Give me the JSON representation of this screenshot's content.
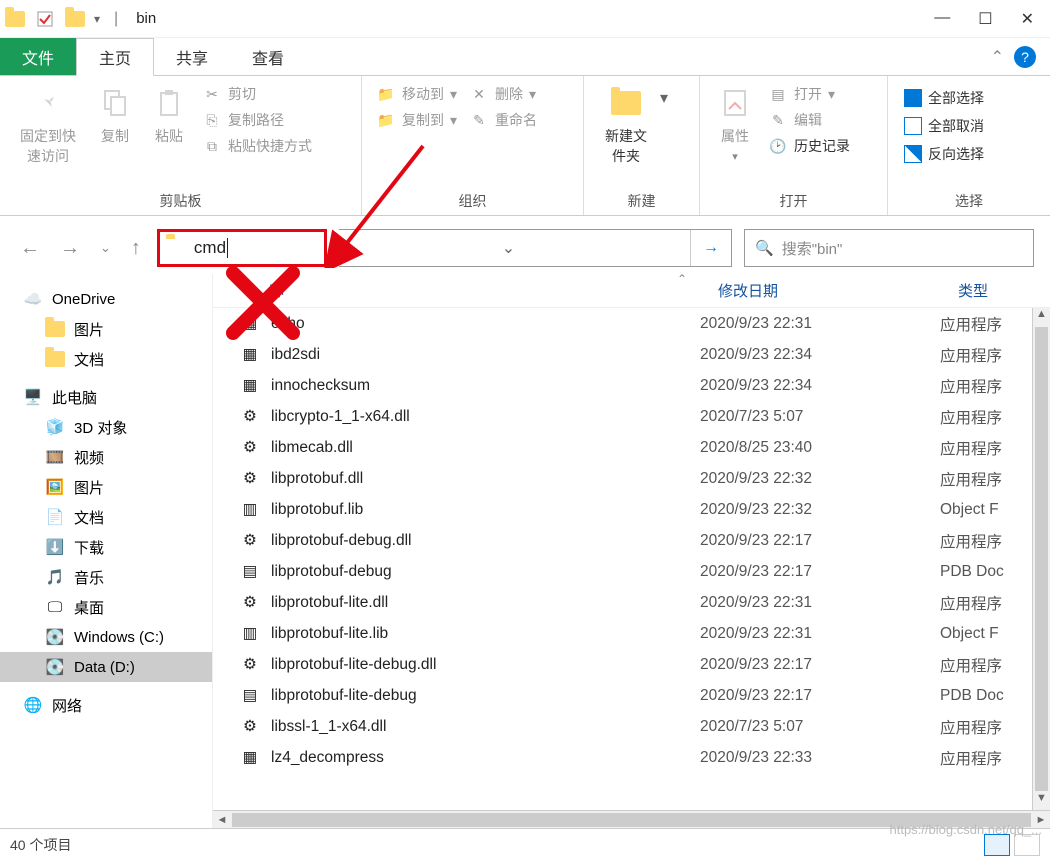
{
  "window": {
    "title": "bin"
  },
  "tabs": {
    "file": "文件",
    "home": "主页",
    "share": "共享",
    "view": "查看"
  },
  "ribbon": {
    "pin": "固定到快速访问",
    "copy": "复制",
    "paste": "粘贴",
    "cut": "剪切",
    "copypath": "复制路径",
    "pasteshortcut": "粘贴快捷方式",
    "clipboard_label": "剪贴板",
    "moveto": "移动到",
    "copyto": "复制到",
    "delete": "删除",
    "rename": "重命名",
    "organize_label": "组织",
    "newfolder": "新建文件夹",
    "new_label": "新建",
    "properties": "属性",
    "open": "打开",
    "edit": "编辑",
    "history": "历史记录",
    "open_label": "打开",
    "selectall": "全部选择",
    "selectnone": "全部取消",
    "invert": "反向选择",
    "select_label": "选择"
  },
  "address": {
    "value": "cmd",
    "search_placeholder": "搜索\"bin\""
  },
  "columns": {
    "name": "称",
    "date": "修改日期",
    "type": "类型"
  },
  "sidebar": {
    "onedrive": "OneDrive",
    "pictures": "图片",
    "documents": "文档",
    "thispc": "此电脑",
    "objects3d": "3D 对象",
    "videos": "视频",
    "pictures2": "图片",
    "documents2": "文档",
    "downloads": "下载",
    "music": "音乐",
    "desktop": "桌面",
    "drive_c": "Windows (C:)",
    "drive_d": "Data (D:)",
    "network": "网络"
  },
  "files": [
    {
      "icon": "exe",
      "name": "echo",
      "date": "2020/9/23 22:31",
      "type": "应用程序"
    },
    {
      "icon": "exe",
      "name": "ibd2sdi",
      "date": "2020/9/23 22:34",
      "type": "应用程序"
    },
    {
      "icon": "exe",
      "name": "innochecksum",
      "date": "2020/9/23 22:34",
      "type": "应用程序"
    },
    {
      "icon": "dll",
      "name": "libcrypto-1_1-x64.dll",
      "date": "2020/7/23 5:07",
      "type": "应用程序"
    },
    {
      "icon": "dll",
      "name": "libmecab.dll",
      "date": "2020/8/25 23:40",
      "type": "应用程序"
    },
    {
      "icon": "dll",
      "name": "libprotobuf.dll",
      "date": "2020/9/23 22:32",
      "type": "应用程序"
    },
    {
      "icon": "lib",
      "name": "libprotobuf.lib",
      "date": "2020/9/23 22:32",
      "type": "Object F"
    },
    {
      "icon": "dll",
      "name": "libprotobuf-debug.dll",
      "date": "2020/9/23 22:17",
      "type": "应用程序"
    },
    {
      "icon": "pdb",
      "name": "libprotobuf-debug",
      "date": "2020/9/23 22:17",
      "type": "PDB Doc"
    },
    {
      "icon": "dll",
      "name": "libprotobuf-lite.dll",
      "date": "2020/9/23 22:31",
      "type": "应用程序"
    },
    {
      "icon": "lib",
      "name": "libprotobuf-lite.lib",
      "date": "2020/9/23 22:31",
      "type": "Object F"
    },
    {
      "icon": "dll",
      "name": "libprotobuf-lite-debug.dll",
      "date": "2020/9/23 22:17",
      "type": "应用程序"
    },
    {
      "icon": "pdb",
      "name": "libprotobuf-lite-debug",
      "date": "2020/9/23 22:17",
      "type": "PDB Doc"
    },
    {
      "icon": "dll",
      "name": "libssl-1_1-x64.dll",
      "date": "2020/7/23 5:07",
      "type": "应用程序"
    },
    {
      "icon": "exe",
      "name": "lz4_decompress",
      "date": "2020/9/23 22:33",
      "type": "应用程序"
    }
  ],
  "status": {
    "count": "40 个项目"
  },
  "watermark": "https://blog.csdn.net/qq_..."
}
